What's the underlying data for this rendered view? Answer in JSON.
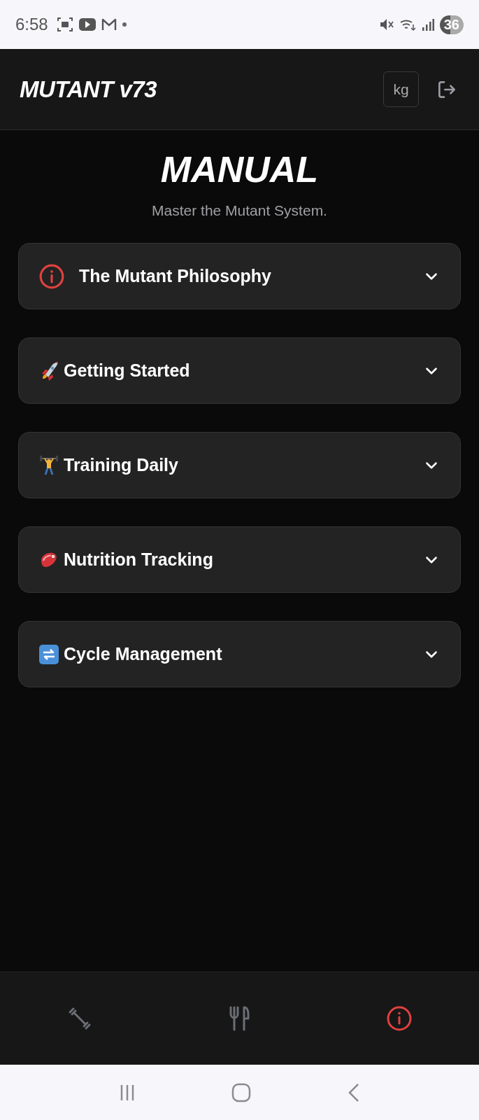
{
  "status_bar": {
    "time": "6:58",
    "battery": "36"
  },
  "header": {
    "title": "MUTANT v73",
    "unit_button": "kg"
  },
  "page": {
    "title": "MANUAL",
    "subtitle": "Master the Mutant System."
  },
  "sections": [
    {
      "kind": "info",
      "title": "The Mutant Philosophy",
      "expanded": false
    },
    {
      "kind": "rocket",
      "title": "Getting Started",
      "expanded": false
    },
    {
      "kind": "lifter",
      "title": "Training Daily",
      "expanded": false
    },
    {
      "kind": "meat",
      "title": "Nutrition Tracking",
      "expanded": false
    },
    {
      "kind": "cycle",
      "title": "Cycle Management",
      "expanded": false
    }
  ],
  "bottom_nav": [
    {
      "kind": "dumbbell",
      "selected": false
    },
    {
      "kind": "cutlery",
      "selected": false
    },
    {
      "kind": "info",
      "selected": true
    }
  ]
}
